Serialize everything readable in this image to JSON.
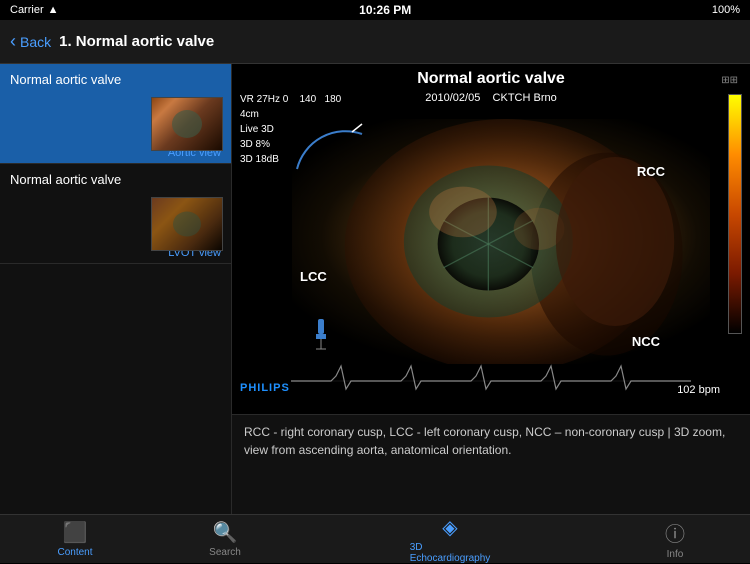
{
  "statusBar": {
    "carrier": "Carrier",
    "wifi": "WiFi",
    "time": "10:26 PM",
    "battery": "100%"
  },
  "navBar": {
    "backLabel": "Back",
    "title": "1. Normal aortic valve"
  },
  "sidebar": {
    "items": [
      {
        "id": "item-normal-aortic-active",
        "title": "Normal aortic valve",
        "subtitle": "Aortic view",
        "active": true
      },
      {
        "id": "item-normal-aortic-lvot",
        "title": "Normal aortic valve",
        "subtitle": "LVOT view",
        "active": false
      }
    ]
  },
  "contentHeader": {
    "title": "Normal aortic valve",
    "date": "2010/02/05",
    "institution": "CKTCH Brno"
  },
  "echoOverlay": {
    "vrHz": "VR 27Hz 0",
    "range1": "140",
    "range2": "180",
    "depth": "4cm",
    "mode1": "Live 3D",
    "mode2": "3D 8%",
    "mode3": "3D 18dB"
  },
  "labels": {
    "rcc": "RCC",
    "lcc": "LCC",
    "ncc": "NCC"
  },
  "ecg": {
    "bpm": "102 bpm"
  },
  "philips": {
    "logo": "PHILIPS"
  },
  "caption": {
    "text": "RCC - right coronary cusp, LCC - left coronary cusp, NCC – non-coronary cusp | 3D zoom, view from ascending aorta, anatomical orientation."
  },
  "tabBar": {
    "tabs": [
      {
        "id": "tab-content",
        "label": "Content",
        "active": false,
        "icon": "folder"
      },
      {
        "id": "tab-search",
        "label": "Search",
        "active": false,
        "icon": "search"
      },
      {
        "id": "tab-3d",
        "label": "3D",
        "active": true,
        "icon": "cube"
      },
      {
        "id": "tab-echocardiography",
        "label": "Echocardiography",
        "active": true,
        "icon": "echo"
      },
      {
        "id": "tab-info",
        "label": "Info",
        "active": false,
        "icon": "info"
      }
    ]
  }
}
